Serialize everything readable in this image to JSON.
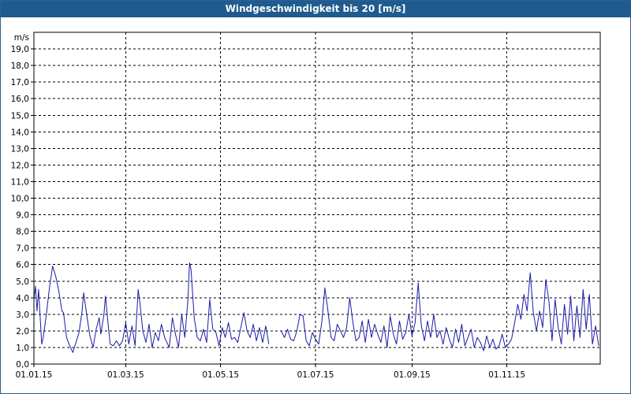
{
  "window": {
    "title": "Windgeschwindigkeit bis 20 [m/s]"
  },
  "chart_data": {
    "type": "line",
    "title": "Windgeschwindigkeit bis 20 [m/s]",
    "ylabel": "m/s",
    "xlabel": "",
    "ylim": [
      0,
      20
    ],
    "xlim": [
      "2015-01-01",
      "2015-12-31"
    ],
    "grid": true,
    "y_ticks": [
      "0,0",
      "1,0",
      "2,0",
      "3,0",
      "4,0",
      "5,0",
      "6,0",
      "7,0",
      "8,0",
      "9,0",
      "10,0",
      "11,0",
      "12,0",
      "13,0",
      "14,0",
      "15,0",
      "16,0",
      "17,0",
      "18,0",
      "19,0"
    ],
    "x_ticks": [
      {
        "date": "2015-01-01",
        "label": "01.01.15"
      },
      {
        "date": "2015-03-01",
        "label": "01.03.15"
      },
      {
        "date": "2015-05-01",
        "label": "01.05.15"
      },
      {
        "date": "2015-07-01",
        "label": "01.07.15"
      },
      {
        "date": "2015-09-01",
        "label": "01.09.15"
      },
      {
        "date": "2015-11-01",
        "label": "01.11.15"
      }
    ],
    "series": [
      {
        "color": "#1a1aa6",
        "segments": [
          [
            [
              "2015-01-01",
              3.9
            ],
            [
              "2015-01-02",
              4.7
            ],
            [
              "2015-01-03",
              3.2
            ],
            [
              "2015-01-04",
              4.5
            ],
            [
              "2015-01-06",
              1.2
            ],
            [
              "2015-01-07",
              1.6
            ],
            [
              "2015-01-09",
              3.0
            ],
            [
              "2015-01-11",
              4.6
            ],
            [
              "2015-01-13",
              5.9
            ],
            [
              "2015-01-15",
              5.3
            ],
            [
              "2015-01-17",
              4.4
            ],
            [
              "2015-01-19",
              3.2
            ],
            [
              "2015-01-20",
              3.1
            ],
            [
              "2015-01-22",
              1.6
            ],
            [
              "2015-01-24",
              1.1
            ],
            [
              "2015-01-26",
              0.7
            ],
            [
              "2015-01-28",
              1.3
            ],
            [
              "2015-01-30",
              1.9
            ],
            [
              "2015-02-01",
              3.2
            ],
            [
              "2015-02-02",
              4.3
            ],
            [
              "2015-02-04",
              2.9
            ],
            [
              "2015-02-06",
              1.7
            ],
            [
              "2015-02-08",
              1.0
            ],
            [
              "2015-02-10",
              2.1
            ],
            [
              "2015-02-12",
              2.8
            ],
            [
              "2015-02-13",
              1.8
            ],
            [
              "2015-02-15",
              3.0
            ],
            [
              "2015-02-16",
              4.1
            ],
            [
              "2015-02-18",
              2.1
            ],
            [
              "2015-02-19",
              1.2
            ],
            [
              "2015-02-21",
              1.1
            ],
            [
              "2015-02-23",
              1.4
            ],
            [
              "2015-02-25",
              1.1
            ],
            [
              "2015-02-27",
              1.4
            ],
            [
              "2015-03-01",
              2.5
            ],
            [
              "2015-03-03",
              1.2
            ],
            [
              "2015-03-05",
              2.3
            ],
            [
              "2015-03-07",
              1.1
            ],
            [
              "2015-03-09",
              4.5
            ],
            [
              "2015-03-10",
              3.8
            ],
            [
              "2015-03-12",
              2.0
            ],
            [
              "2015-03-14",
              1.3
            ],
            [
              "2015-03-16",
              2.4
            ],
            [
              "2015-03-18",
              1.0
            ],
            [
              "2015-03-20",
              1.9
            ],
            [
              "2015-03-22",
              1.4
            ],
            [
              "2015-03-24",
              2.4
            ],
            [
              "2015-03-26",
              1.6
            ],
            [
              "2015-03-28",
              1.2
            ],
            [
              "2015-03-29",
              1.0
            ],
            [
              "2015-03-31",
              2.8
            ],
            [
              "2015-04-02",
              1.8
            ],
            [
              "2015-04-04",
              1.0
            ],
            [
              "2015-04-06",
              3.0
            ],
            [
              "2015-04-08",
              1.6
            ],
            [
              "2015-04-10",
              3.9
            ],
            [
              "2015-04-11",
              6.1
            ],
            [
              "2015-04-12",
              5.7
            ],
            [
              "2015-04-14",
              2.8
            ],
            [
              "2015-04-16",
              1.6
            ],
            [
              "2015-04-18",
              1.4
            ],
            [
              "2015-04-20",
              2.1
            ],
            [
              "2015-04-22",
              1.3
            ],
            [
              "2015-04-24",
              3.9
            ],
            [
              "2015-04-26",
              2.1
            ],
            [
              "2015-04-28",
              1.9
            ],
            [
              "2015-04-30",
              1.1
            ],
            [
              "2015-05-02",
              2.2
            ],
            [
              "2015-05-04",
              1.6
            ],
            [
              "2015-05-06",
              2.5
            ],
            [
              "2015-05-08",
              1.5
            ],
            [
              "2015-05-10",
              1.6
            ],
            [
              "2015-05-12",
              1.3
            ],
            [
              "2015-05-14",
              2.2
            ],
            [
              "2015-05-16",
              3.1
            ],
            [
              "2015-05-18",
              2.0
            ],
            [
              "2015-05-20",
              1.6
            ],
            [
              "2015-05-22",
              2.4
            ],
            [
              "2015-05-24",
              1.4
            ],
            [
              "2015-05-26",
              2.2
            ],
            [
              "2015-05-28",
              1.3
            ],
            [
              "2015-05-30",
              2.3
            ],
            [
              "2015-06-01",
              1.2
            ]
          ],
          [
            [
              "2015-06-09",
              2.0
            ],
            [
              "2015-06-11",
              1.6
            ],
            [
              "2015-06-13",
              2.1
            ],
            [
              "2015-06-15",
              1.5
            ],
            [
              "2015-06-17",
              1.4
            ],
            [
              "2015-06-19",
              2.0
            ],
            [
              "2015-06-21",
              3.0
            ],
            [
              "2015-06-23",
              2.9
            ],
            [
              "2015-06-25",
              1.4
            ],
            [
              "2015-06-27",
              1.1
            ],
            [
              "2015-06-29",
              1.9
            ],
            [
              "2015-07-01",
              1.5
            ],
            [
              "2015-07-03",
              1.2
            ],
            [
              "2015-07-05",
              2.5
            ],
            [
              "2015-07-07",
              4.6
            ],
            [
              "2015-07-09",
              3.2
            ],
            [
              "2015-07-11",
              1.6
            ],
            [
              "2015-07-13",
              1.4
            ],
            [
              "2015-07-15",
              2.4
            ],
            [
              "2015-07-17",
              2.0
            ],
            [
              "2015-07-19",
              1.6
            ],
            [
              "2015-07-21",
              2.2
            ],
            [
              "2015-07-23",
              4.0
            ],
            [
              "2015-07-25",
              2.5
            ],
            [
              "2015-07-27",
              1.4
            ],
            [
              "2015-07-29",
              1.6
            ],
            [
              "2015-07-31",
              2.6
            ],
            [
              "2015-08-02",
              1.3
            ],
            [
              "2015-08-04",
              2.7
            ],
            [
              "2015-08-06",
              1.6
            ],
            [
              "2015-08-08",
              2.4
            ],
            [
              "2015-08-10",
              1.8
            ],
            [
              "2015-08-12",
              1.3
            ],
            [
              "2015-08-14",
              2.3
            ],
            [
              "2015-08-16",
              1.0
            ],
            [
              "2015-08-18",
              2.9
            ],
            [
              "2015-08-20",
              1.8
            ],
            [
              "2015-08-22",
              1.2
            ],
            [
              "2015-08-24",
              2.6
            ],
            [
              "2015-08-26",
              1.5
            ],
            [
              "2015-08-28",
              1.9
            ],
            [
              "2015-08-30",
              3.0
            ],
            [
              "2015-09-01",
              1.7
            ],
            [
              "2015-09-03",
              2.5
            ],
            [
              "2015-09-05",
              4.9
            ],
            [
              "2015-09-07",
              2.3
            ],
            [
              "2015-09-09",
              1.4
            ],
            [
              "2015-09-11",
              2.6
            ],
            [
              "2015-09-13",
              1.6
            ],
            [
              "2015-09-15",
              3.0
            ],
            [
              "2015-09-17",
              1.6
            ],
            [
              "2015-09-19",
              2.0
            ],
            [
              "2015-09-21",
              1.2
            ],
            [
              "2015-09-23",
              2.2
            ],
            [
              "2015-09-25",
              1.5
            ],
            [
              "2015-09-27",
              1.0
            ],
            [
              "2015-09-29",
              2.1
            ],
            [
              "2015-10-01",
              1.3
            ],
            [
              "2015-10-03",
              2.4
            ],
            [
              "2015-10-05",
              1.1
            ],
            [
              "2015-10-07",
              1.6
            ],
            [
              "2015-10-09",
              2.1
            ],
            [
              "2015-10-11",
              1.0
            ],
            [
              "2015-10-13",
              1.6
            ],
            [
              "2015-10-15",
              1.3
            ],
            [
              "2015-10-17",
              0.8
            ],
            [
              "2015-10-19",
              1.7
            ],
            [
              "2015-10-21",
              1.0
            ],
            [
              "2015-10-23",
              1.5
            ],
            [
              "2015-10-25",
              0.9
            ],
            [
              "2015-10-27",
              1.1
            ],
            [
              "2015-10-29",
              1.8
            ],
            [
              "2015-10-31",
              1.0
            ],
            [
              "2015-11-02",
              1.2
            ],
            [
              "2015-11-04",
              1.5
            ],
            [
              "2015-11-06",
              2.5
            ],
            [
              "2015-11-08",
              3.6
            ],
            [
              "2015-11-10",
              2.7
            ],
            [
              "2015-11-12",
              4.2
            ],
            [
              "2015-11-14",
              3.2
            ],
            [
              "2015-11-16",
              5.5
            ],
            [
              "2015-11-18",
              3.1
            ],
            [
              "2015-11-20",
              2.0
            ],
            [
              "2015-11-22",
              3.2
            ],
            [
              "2015-11-24",
              2.2
            ],
            [
              "2015-11-26",
              5.1
            ],
            [
              "2015-11-28",
              3.8
            ],
            [
              "2015-11-30",
              1.4
            ],
            [
              "2015-12-02",
              3.9
            ],
            [
              "2015-12-04",
              2.2
            ],
            [
              "2015-12-06",
              1.2
            ],
            [
              "2015-12-08",
              3.6
            ],
            [
              "2015-12-10",
              1.8
            ],
            [
              "2015-12-12",
              4.1
            ],
            [
              "2015-12-14",
              1.4
            ],
            [
              "2015-12-16",
              3.5
            ],
            [
              "2015-12-18",
              1.6
            ],
            [
              "2015-12-20",
              4.5
            ],
            [
              "2015-12-22",
              2.1
            ],
            [
              "2015-12-24",
              4.2
            ],
            [
              "2015-12-26",
              1.2
            ],
            [
              "2015-12-28",
              2.3
            ],
            [
              "2015-12-30",
              1.1
            ]
          ]
        ]
      }
    ]
  }
}
